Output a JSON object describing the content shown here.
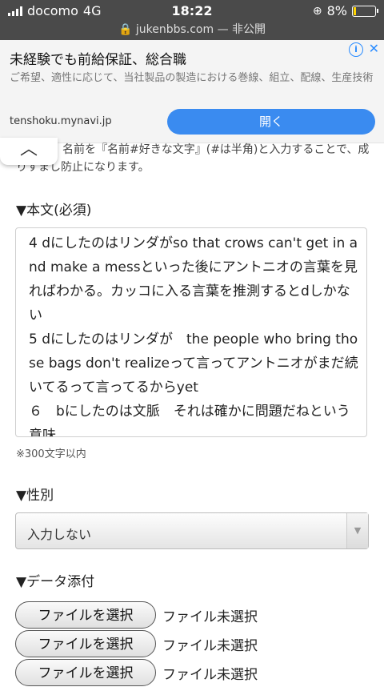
{
  "status_bar": {
    "carrier": "docomo",
    "network": "4G",
    "time": "18:22",
    "battery": "8%",
    "battery_color": "#ffd400",
    "url": "🔒 jukenbbs.com — 非公開"
  },
  "ad": {
    "title": "未経験でも前給保証、総合職",
    "info_icon": "i",
    "close_icon": "✕",
    "description": "ご希望、適性に応じて、当社製品の製造における巻線、組立、配線、生産技術",
    "domain": "tenshoku.mynavi.jp",
    "open_button": "開く",
    "button_color": "#3a8bf0"
  },
  "collapse_icon": "︿",
  "name_hint_line1": "名前を『名前#好きな文字』(#は半角)と入力することで、成",
  "name_hint_line2": "りすまし防止になります。",
  "body_label": "▼本文(必須)",
  "body_text": "4 dにしたのはリンダがso that crows can't get in and make a messといった後にアントニオの言葉を見ればわかる。カッコに入る言葉を推測するとdしかない\n5 dにしたのはリンダが　the people who bring those bags don't realizeって言ってアントニオがまだ続いてるって言ってるからyet\n６　bにしたのは文脈　それは確かに問題だねという意味",
  "body_note": "※300文字以内",
  "gender_label": "▼性別",
  "gender_select_value": "入力しない",
  "attach_label": "▼データ添付",
  "file_inputs": [
    {
      "button": "ファイルを選択",
      "status": "ファイル未選択"
    },
    {
      "button": "ファイルを選択",
      "status": "ファイル未選択"
    },
    {
      "button": "ファイルを選択",
      "status": "ファイル未選択"
    }
  ]
}
